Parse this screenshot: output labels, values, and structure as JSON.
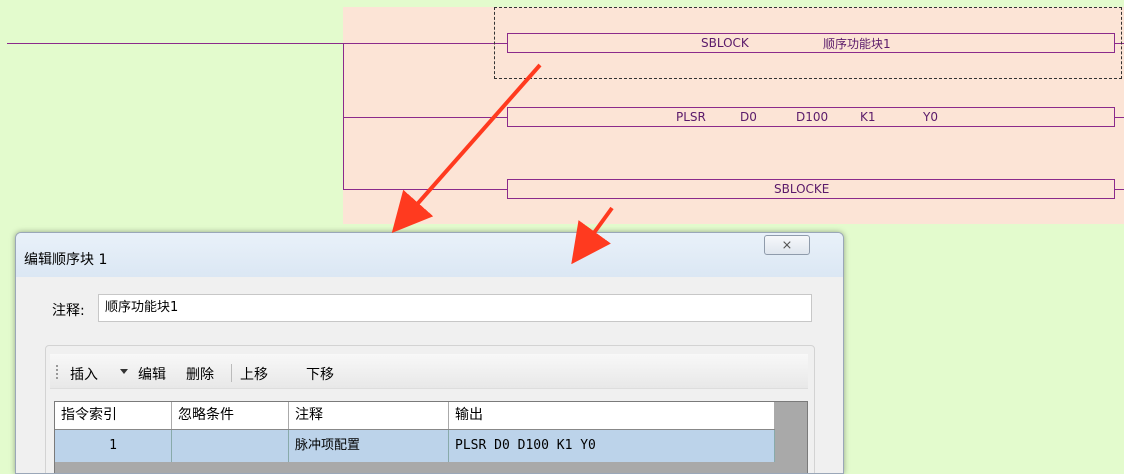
{
  "ladder": {
    "rung1_instruction": "SBLOCK",
    "rung1_comment": "顺序功能块1",
    "rung2_op": "PLSR",
    "rung2_arg1": "D0",
    "rung2_arg2": "D100",
    "rung2_arg3": "K1",
    "rung2_arg4": "Y0",
    "rung3_instruction": "SBLOCKE"
  },
  "colors": {
    "background": "#e3fbcd",
    "block_area": "#fce4d6",
    "wire": "#8b2a8b",
    "arrow": "#ff3a1f",
    "row_selected": "#bcd3ea"
  },
  "dialog": {
    "title": "编辑顺序块 1",
    "close_symbol": "⨯",
    "comment_label": "注释:",
    "comment_value": "顺序功能块1",
    "toolbar": {
      "insert": "插入",
      "edit": "编辑",
      "delete": "删除",
      "move_up": "上移",
      "move_down": "下移"
    },
    "table": {
      "headers": [
        "指令索引",
        "忽略条件",
        "注释",
        "输出"
      ],
      "rows": [
        {
          "index": "1",
          "ignore": "",
          "comment": "脉冲项配置",
          "output": "PLSR D0 D100 K1 Y0"
        }
      ]
    }
  }
}
